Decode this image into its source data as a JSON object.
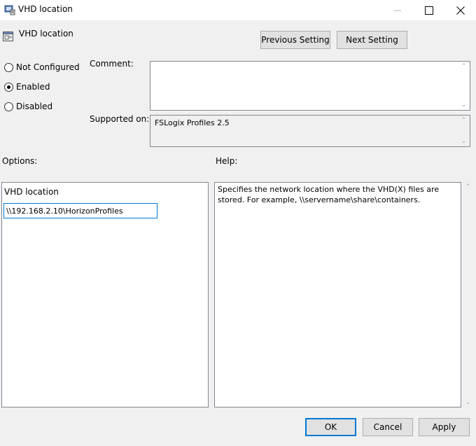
{
  "window": {
    "title": "VHD location",
    "minimize_glyph": "—",
    "maximize_glyph": "☐",
    "close_glyph": "✕"
  },
  "header": {
    "title": "VHD location",
    "prev_label": "Previous Setting",
    "next_label": "Next Setting"
  },
  "state": {
    "options": [
      {
        "label": "Not Configured",
        "selected": false
      },
      {
        "label": "Enabled",
        "selected": true
      },
      {
        "label": "Disabled",
        "selected": false
      }
    ]
  },
  "comment": {
    "label": "Comment:",
    "value": ""
  },
  "supported": {
    "label": "Supported on:",
    "value": "FSLogix Profiles 2.5"
  },
  "options_section": {
    "label": "Options:",
    "field_label": "VHD location",
    "field_value": "\\\\192.168.2.10\\HorizonProfiles"
  },
  "help_section": {
    "label": "Help:",
    "text": "Specifies the network location where the VHD(X) files are stored. For example, \\\\servername\\share\\containers."
  },
  "footer": {
    "ok_label": "OK",
    "cancel_label": "Cancel",
    "apply_label": "Apply"
  },
  "colors": {
    "accent": "#0078d7",
    "background": "#f0f0f0"
  }
}
